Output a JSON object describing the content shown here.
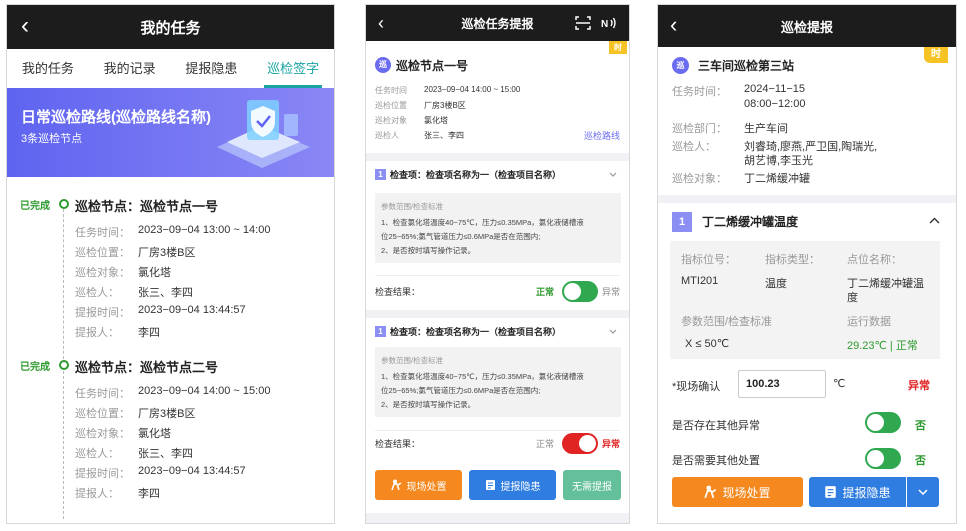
{
  "p1": {
    "title": "我的任务",
    "tabs": [
      "我的任务",
      "我的记录",
      "提报隐患",
      "巡检签字"
    ],
    "banner": {
      "title": "日常巡检路线(巡检路线名称)",
      "sub": "3条巡检节点"
    },
    "nodes": [
      {
        "status": "已完成",
        "title": "巡检节点：巡检节点一号",
        "rows": [
          [
            "任务时间：",
            "2023−09−04 13:00 ~ 14:00"
          ],
          [
            "巡检位置：",
            "厂房3楼B区"
          ],
          [
            "巡检对象：",
            "氯化塔"
          ],
          [
            "巡检人：",
            "张三、李四"
          ],
          [
            "提报时间：",
            "2023−09−04 13:44:57"
          ],
          [
            "提报人：",
            "李四"
          ]
        ]
      },
      {
        "status": "已完成",
        "title": "巡检节点：巡检节点二号",
        "rows": [
          [
            "任务时间：",
            "2023−09−04 14:00 ~ 15:00"
          ],
          [
            "巡检位置：",
            "厂房3楼B区"
          ],
          [
            "巡检对象：",
            "氯化塔"
          ],
          [
            "巡检人：",
            "张三、李四"
          ],
          [
            "提报时间：",
            "2023−09−04 13:44:57"
          ],
          [
            "提报人：",
            "李四"
          ]
        ]
      }
    ]
  },
  "p2": {
    "title": "巡检任务提报",
    "badge": "时",
    "node_circle": "巡",
    "node_title": "巡检节点一号",
    "info": [
      [
        "任务时间",
        "2023−09−04 14:00 ~ 15:00"
      ],
      [
        "巡检位置",
        "厂房3楼B区"
      ],
      [
        "巡检对象",
        "氯化塔"
      ],
      [
        "巡检人",
        "张三、李四"
      ]
    ],
    "route_link": "巡检路线",
    "checks": [
      {
        "idx": "1",
        "title": "检查项：检查项名称为一（检查项目名称）",
        "box_head": "参数范围/检查标准",
        "box_lines": [
          "1、检查氯化塔温度40−75℃，压力≤0.35MPa，氯化液储槽液",
          "位25−65%;氯气管道压力≤0.6MPa是否在范围内;",
          "2、是否按时填写操作记录。"
        ],
        "result_label": "检查结果：",
        "state_text": "正常",
        "alt_text": "异常",
        "toggle_on": true
      },
      {
        "idx": "1",
        "title": "检查项：检查项名称为一（检查项目名称）",
        "box_head": "参数范围/检查标准",
        "box_lines": [
          "1、检查氯化塔温度40−75℃，压力≤0.35MPa，氯化液储槽液",
          "位25−65%;氯气管道压力≤0.6MPa是否在范围内;",
          "2、是否按时填写操作记录。"
        ],
        "result_label": "检查结果：",
        "state_text": "正常",
        "alt_text": "异常",
        "toggle_on": false
      }
    ],
    "buttons": {
      "site": "现场处置",
      "report": "提报隐患",
      "none": "无需提报"
    },
    "colors": {
      "orange": "#f5891f",
      "blue": "#2f7de0",
      "green": "#63c09a",
      "red": "#e02424",
      "accent": "#6a6cf0"
    }
  },
  "p3": {
    "title": "巡检提报",
    "badge": "时",
    "node_circle": "巡",
    "node_title": "三车间巡检第三站",
    "info": {
      "time_label": "任务时间：",
      "time_v1": "2024−11−15",
      "time_v2": "08:00−12:00",
      "dept_label": "巡检部门：",
      "dept_v": "生产车间",
      "people_label": "巡检人：",
      "people_v1": "刘睿琦,廖燕,严卫国,陶瑞光,",
      "people_v2": "胡艺博,李玉光",
      "obj_label": "巡检对象：",
      "obj_v": "丁二烯缓冲罐"
    },
    "section": {
      "idx": "1",
      "title": "丁二烯缓冲罐温度"
    },
    "grid": {
      "h1": "指标位号：",
      "h2": "指标类型：",
      "h3": "点位名称：",
      "v1": "MTI201",
      "v2": "温度",
      "v3a": "丁二烯缓冲罐温",
      "v3b": "度",
      "h4": "参数范围/检查标准",
      "h5": "运行数据",
      "v4": "X ≤ 50℃",
      "v5": "29.23℃ | 正常"
    },
    "confirm": {
      "label": "*现场确认",
      "value": "100.23",
      "unit": "℃",
      "status": "异常"
    },
    "q1": {
      "label": "是否存在其他异常",
      "state": "否"
    },
    "q2": {
      "label": "是否需要其他处置",
      "state": "否"
    },
    "buttons": {
      "site": "现场处置",
      "report": "提报隐患"
    }
  }
}
